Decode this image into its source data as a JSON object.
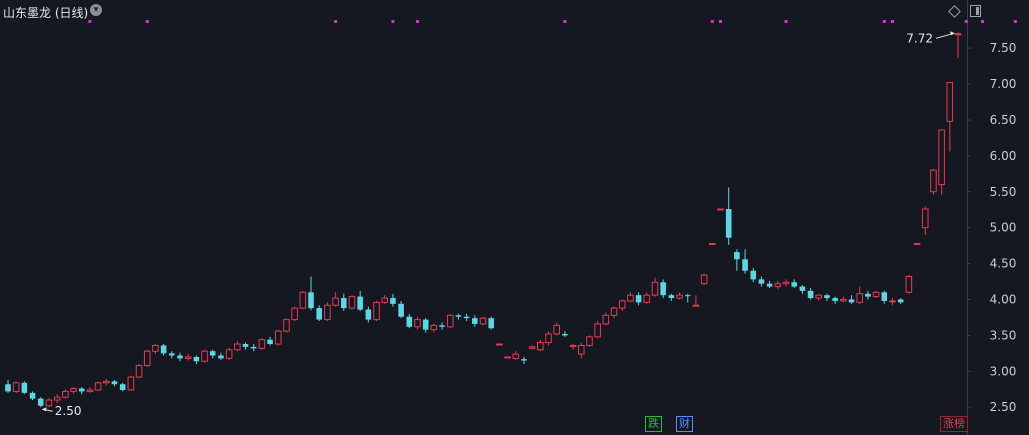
{
  "title": "山东墨龙 (日线)",
  "colors": {
    "up": "#e8384f",
    "down": "#5ad8e6",
    "marker": "#d234d2",
    "bg": "#151821",
    "axis_text": "#c8ccd4"
  },
  "icons": {
    "dropdown": "chevron-down-icon",
    "diamond": "diamond-icon",
    "panel": "panel-toggle-icon"
  },
  "badges": [
    {
      "label": "跌",
      "color": "#1fbf3f",
      "border": "#1fbf3f"
    },
    {
      "label": "财",
      "color": "#5b8cff",
      "border": "#5b8cff"
    },
    {
      "label": "涨榜",
      "color": "#e8384f",
      "border": "#a0202e"
    }
  ],
  "chart_data": {
    "type": "candlestick",
    "ylim": [
      2.35,
      7.78
    ],
    "y_ticks": [
      "7.50",
      "7.00",
      "6.50",
      "6.00",
      "5.50",
      "5.00",
      "4.50",
      "4.00",
      "3.50",
      "3.00",
      "2.50"
    ],
    "annotations": {
      "high_label": "7.72",
      "low_label": "2.50"
    },
    "candles": [
      [
        2.82,
        2.72,
        2.88,
        2.7
      ],
      [
        2.72,
        2.84,
        2.86,
        2.7
      ],
      [
        2.84,
        2.7,
        2.86,
        2.68
      ],
      [
        2.7,
        2.62,
        2.72,
        2.6
      ],
      [
        2.62,
        2.52,
        2.64,
        2.5
      ],
      [
        2.52,
        2.6,
        2.63,
        2.5
      ],
      [
        2.6,
        2.64,
        2.68,
        2.56
      ],
      [
        2.64,
        2.72,
        2.75,
        2.62
      ],
      [
        2.72,
        2.76,
        2.78,
        2.69
      ],
      [
        2.76,
        2.72,
        2.78,
        2.68
      ],
      [
        2.72,
        2.74,
        2.78,
        2.7
      ],
      [
        2.74,
        2.84,
        2.86,
        2.73
      ],
      [
        2.84,
        2.86,
        2.9,
        2.8
      ],
      [
        2.86,
        2.82,
        2.88,
        2.79
      ],
      [
        2.82,
        2.74,
        2.84,
        2.72
      ],
      [
        2.74,
        2.92,
        2.94,
        2.73
      ],
      [
        2.92,
        3.08,
        3.1,
        2.9
      ],
      [
        3.08,
        3.28,
        3.3,
        3.06
      ],
      [
        3.28,
        3.36,
        3.38,
        3.24
      ],
      [
        3.36,
        3.25,
        3.38,
        3.22
      ],
      [
        3.25,
        3.22,
        3.28,
        3.18
      ],
      [
        3.22,
        3.18,
        3.26,
        3.14
      ],
      [
        3.18,
        3.2,
        3.24,
        3.15
      ],
      [
        3.2,
        3.14,
        3.22,
        3.1
      ],
      [
        3.14,
        3.28,
        3.3,
        3.12
      ],
      [
        3.28,
        3.22,
        3.3,
        3.18
      ],
      [
        3.22,
        3.18,
        3.26,
        3.16
      ],
      [
        3.18,
        3.3,
        3.33,
        3.16
      ],
      [
        3.3,
        3.38,
        3.42,
        3.28
      ],
      [
        3.38,
        3.34,
        3.4,
        3.3
      ],
      [
        3.34,
        3.32,
        3.38,
        3.28
      ],
      [
        3.32,
        3.44,
        3.46,
        3.3
      ],
      [
        3.44,
        3.38,
        3.48,
        3.36
      ],
      [
        3.38,
        3.56,
        3.58,
        3.36
      ],
      [
        3.56,
        3.72,
        3.74,
        3.54
      ],
      [
        3.72,
        3.88,
        3.9,
        3.7
      ],
      [
        3.88,
        4.1,
        4.12,
        3.86
      ],
      [
        4.1,
        3.88,
        4.32,
        3.85
      ],
      [
        3.88,
        3.72,
        3.92,
        3.7
      ],
      [
        3.72,
        3.92,
        3.96,
        3.7
      ],
      [
        3.92,
        4.02,
        4.1,
        3.9
      ],
      [
        4.02,
        3.88,
        4.08,
        3.84
      ],
      [
        3.88,
        4.04,
        4.06,
        3.86
      ],
      [
        4.04,
        3.86,
        4.12,
        3.84
      ],
      [
        3.86,
        3.72,
        3.9,
        3.68
      ],
      [
        3.72,
        3.96,
        3.98,
        3.7
      ],
      [
        3.96,
        4.02,
        4.06,
        3.94
      ],
      [
        4.02,
        3.94,
        4.08,
        3.9
      ],
      [
        3.94,
        3.76,
        3.98,
        3.74
      ],
      [
        3.76,
        3.62,
        3.8,
        3.6
      ],
      [
        3.62,
        3.72,
        3.76,
        3.58
      ],
      [
        3.72,
        3.58,
        3.74,
        3.54
      ],
      [
        3.58,
        3.64,
        3.66,
        3.54
      ],
      [
        3.64,
        3.62,
        3.68,
        3.58
      ],
      [
        3.62,
        3.78,
        3.8,
        3.6
      ],
      [
        3.78,
        3.76,
        3.8,
        3.72
      ],
      [
        3.76,
        3.74,
        3.8,
        3.7
      ],
      [
        3.74,
        3.66,
        3.78,
        3.62
      ],
      [
        3.66,
        3.74,
        3.76,
        3.64
      ],
      [
        3.74,
        3.6,
        3.76,
        3.58
      ],
      [
        3.38,
        3.38,
        3.38,
        3.38
      ],
      [
        3.2,
        3.2,
        3.2,
        3.2
      ],
      [
        3.18,
        3.24,
        3.28,
        3.16
      ],
      [
        3.17,
        3.15,
        3.2,
        3.1
      ],
      [
        3.32,
        3.34,
        3.36,
        3.3
      ],
      [
        3.3,
        3.4,
        3.44,
        3.28
      ],
      [
        3.4,
        3.52,
        3.56,
        3.36
      ],
      [
        3.52,
        3.64,
        3.68,
        3.5
      ],
      [
        3.52,
        3.5,
        3.56,
        3.48
      ],
      [
        3.36,
        3.36,
        3.38,
        3.3
      ],
      [
        3.24,
        3.36,
        3.4,
        3.18
      ],
      [
        3.36,
        3.48,
        3.5,
        3.34
      ],
      [
        3.48,
        3.66,
        3.7,
        3.46
      ],
      [
        3.66,
        3.78,
        3.82,
        3.64
      ],
      [
        3.78,
        3.88,
        3.9,
        3.74
      ],
      [
        3.88,
        3.98,
        4.0,
        3.84
      ],
      [
        3.98,
        4.06,
        4.1,
        3.96
      ],
      [
        4.06,
        3.96,
        4.1,
        3.92
      ],
      [
        3.96,
        4.06,
        4.1,
        3.94
      ],
      [
        4.06,
        4.24,
        4.3,
        4.04
      ],
      [
        4.24,
        4.06,
        4.28,
        4.02
      ],
      [
        4.06,
        4.02,
        4.08,
        3.98
      ],
      [
        4.02,
        4.06,
        4.1,
        4.0
      ],
      [
        4.06,
        4.05,
        4.08,
        3.96
      ],
      [
        3.92,
        3.92,
        4.06,
        3.9
      ],
      [
        4.22,
        4.34,
        4.36,
        4.2
      ],
      [
        4.78,
        4.78,
        4.78,
        4.78
      ],
      [
        5.26,
        5.26,
        5.26,
        5.26
      ],
      [
        5.26,
        4.86,
        5.56,
        4.76
      ],
      [
        4.66,
        4.56,
        4.7,
        4.4
      ],
      [
        4.56,
        4.4,
        4.7,
        4.36
      ],
      [
        4.4,
        4.28,
        4.44,
        4.24
      ],
      [
        4.28,
        4.22,
        4.32,
        4.18
      ],
      [
        4.22,
        4.18,
        4.26,
        4.16
      ],
      [
        4.18,
        4.22,
        4.26,
        4.14
      ],
      [
        4.22,
        4.24,
        4.28,
        4.18
      ],
      [
        4.24,
        4.18,
        4.28,
        4.16
      ],
      [
        4.18,
        4.12,
        4.2,
        4.08
      ],
      [
        4.12,
        4.02,
        4.16,
        4.0
      ],
      [
        4.02,
        4.06,
        4.08,
        3.98
      ],
      [
        4.06,
        4.02,
        4.08,
        3.98
      ],
      [
        4.02,
        3.98,
        4.04,
        3.94
      ],
      [
        3.98,
        4.0,
        4.04,
        3.96
      ],
      [
        4.0,
        3.96,
        4.06,
        3.94
      ],
      [
        3.96,
        4.08,
        4.18,
        3.94
      ],
      [
        4.08,
        4.04,
        4.12,
        4.0
      ],
      [
        4.04,
        4.1,
        4.12,
        4.02
      ],
      [
        4.1,
        3.98,
        4.12,
        3.94
      ],
      [
        3.98,
        3.98,
        4.02,
        3.92
      ],
      [
        4.0,
        3.96,
        4.02,
        3.94
      ],
      [
        4.1,
        4.32,
        4.34,
        4.08
      ],
      [
        4.78,
        4.78,
        4.78,
        4.78
      ],
      [
        5.0,
        5.26,
        5.3,
        4.9
      ],
      [
        5.5,
        5.8,
        5.82,
        5.46
      ],
      [
        5.6,
        6.36,
        6.36,
        5.46
      ],
      [
        6.48,
        7.02,
        7.02,
        6.06
      ],
      [
        7.7,
        7.7,
        7.72,
        7.36
      ]
    ],
    "marker_columns": [
      10,
      17,
      40,
      47,
      50,
      68,
      86,
      87,
      95,
      107,
      108,
      117,
      119,
      123,
      125,
      132,
      134,
      138,
      143,
      150,
      156,
      158,
      161,
      162,
      165,
      167,
      170,
      172
    ]
  }
}
